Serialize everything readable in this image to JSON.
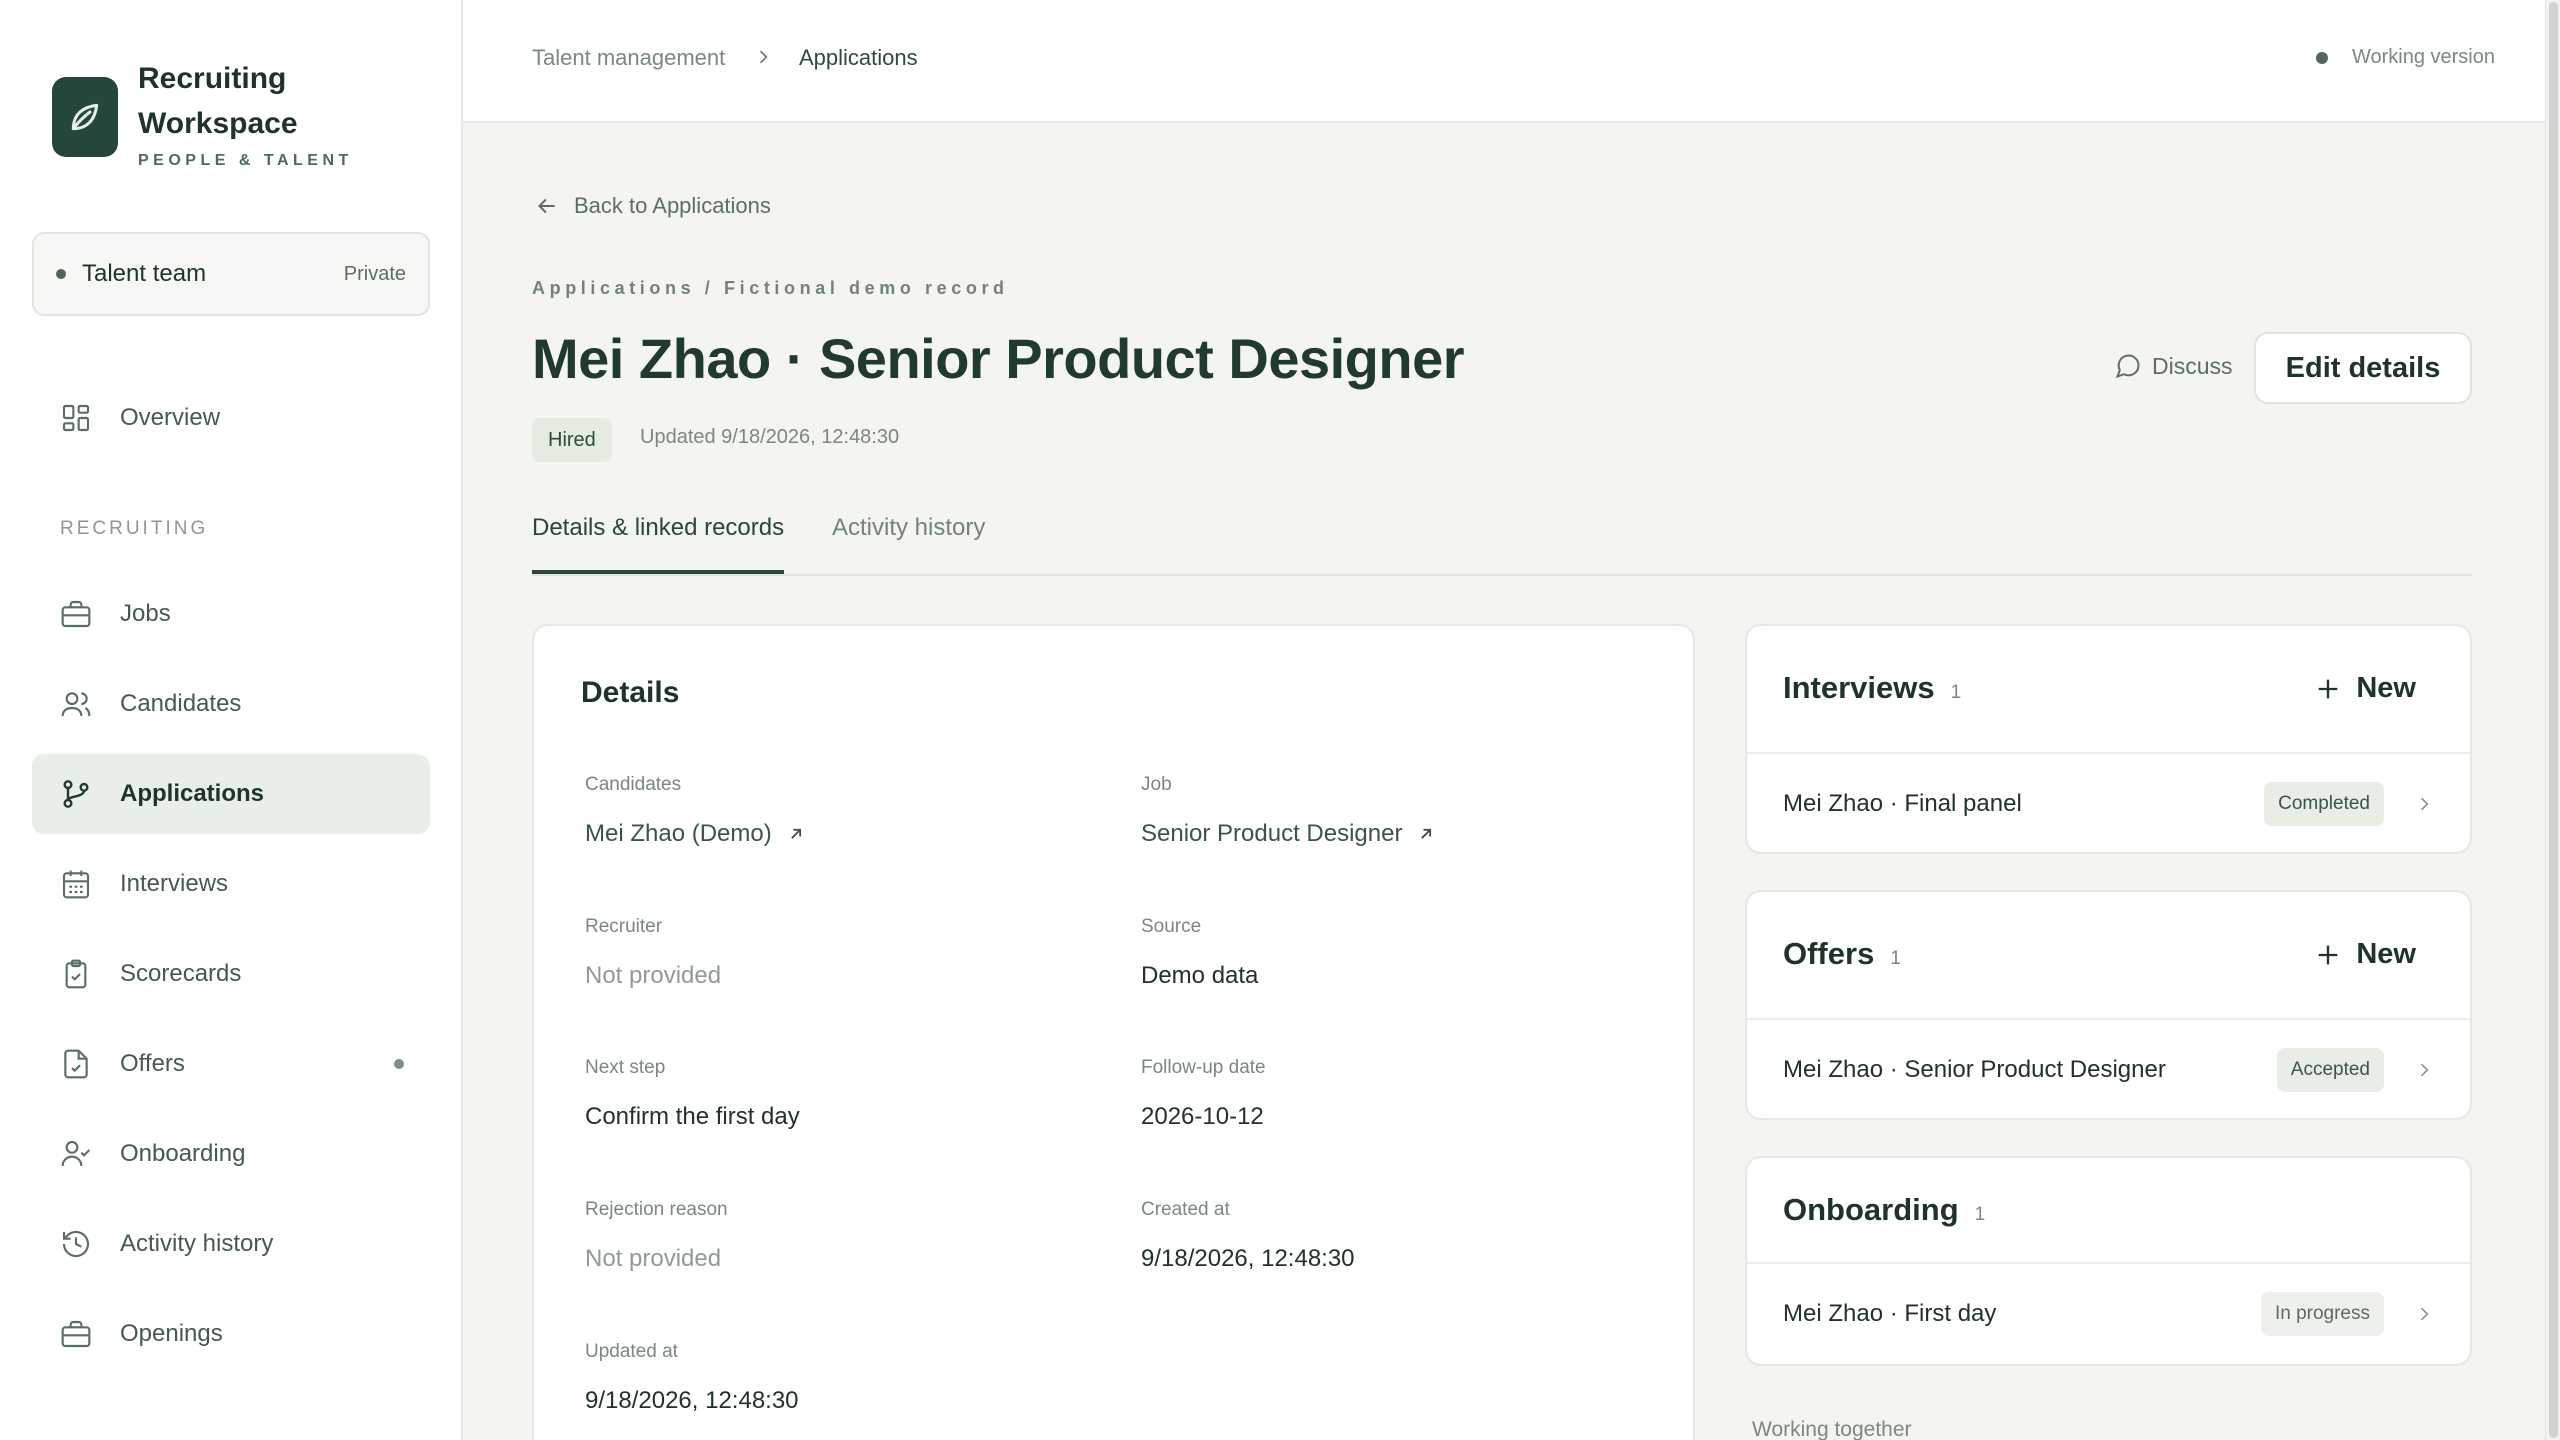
{
  "brand": {
    "name": "Recruiting Workspace",
    "subtitle": "PEOPLE & TALENT"
  },
  "team": {
    "name": "Talent team",
    "visibility": "Private"
  },
  "nav": {
    "overview": "Overview",
    "section": "RECRUITING",
    "items": [
      {
        "id": "jobs",
        "label": "Jobs",
        "icon": "briefcase-icon"
      },
      {
        "id": "candidates",
        "label": "Candidates",
        "icon": "users-icon"
      },
      {
        "id": "applications",
        "label": "Applications",
        "icon": "git-branch-icon",
        "active": true
      },
      {
        "id": "interviews",
        "label": "Interviews",
        "icon": "calendar-icon"
      },
      {
        "id": "scorecards",
        "label": "Scorecards",
        "icon": "clipboard-check-icon"
      },
      {
        "id": "offers",
        "label": "Offers",
        "icon": "file-check-icon",
        "badge": true
      },
      {
        "id": "onboarding",
        "label": "Onboarding",
        "icon": "user-check-icon"
      },
      {
        "id": "activity",
        "label": "Activity history",
        "icon": "history-icon"
      },
      {
        "id": "openings",
        "label": "Openings",
        "icon": "briefcase-icon"
      }
    ]
  },
  "topbar": {
    "breadcrumb": [
      "Talent management",
      "Applications"
    ],
    "version": "Working version"
  },
  "page": {
    "back": "Back to Applications",
    "eyebrow": "Applications / Fictional demo record",
    "title": "Mei Zhao · Senior Product Designer",
    "status": "Hired",
    "updated": "Updated 9/18/2026, 12:48:30",
    "discuss": "Discuss",
    "edit": "Edit details",
    "tabs": [
      "Details & linked records",
      "Activity history"
    ]
  },
  "details": {
    "title": "Details",
    "fields": {
      "candidates": {
        "label": "Candidates",
        "value": "Mei Zhao (Demo)"
      },
      "job": {
        "label": "Job",
        "value": "Senior Product Designer"
      },
      "recruiter": {
        "label": "Recruiter",
        "value": "Not provided"
      },
      "source": {
        "label": "Source",
        "value": "Demo data"
      },
      "next_step": {
        "label": "Next step",
        "value": "Confirm the first day"
      },
      "follow_up": {
        "label": "Follow-up date",
        "value": "2026-10-12"
      },
      "rejection": {
        "label": "Rejection reason",
        "value": "Not provided"
      },
      "created": {
        "label": "Created at",
        "value": "9/18/2026, 12:48:30"
      },
      "updated": {
        "label": "Updated at",
        "value": "9/18/2026, 12:48:30"
      }
    }
  },
  "linked": {
    "new_label": "New",
    "interviews": {
      "title": "Interviews",
      "count": "1",
      "row": "Mei Zhao · Final panel",
      "status": "Completed"
    },
    "offers": {
      "title": "Offers",
      "count": "1",
      "row": "Mei Zhao · Senior Product Designer",
      "status": "Accepted"
    },
    "onboarding": {
      "title": "Onboarding",
      "count": "1",
      "row": "Mei Zhao · First day",
      "status": "In progress"
    }
  },
  "footer": {
    "working": "Working together"
  },
  "colors": {
    "accent": "#25463a",
    "active_bg": "#e8efe6",
    "page_bg": "#f4f4f1"
  }
}
